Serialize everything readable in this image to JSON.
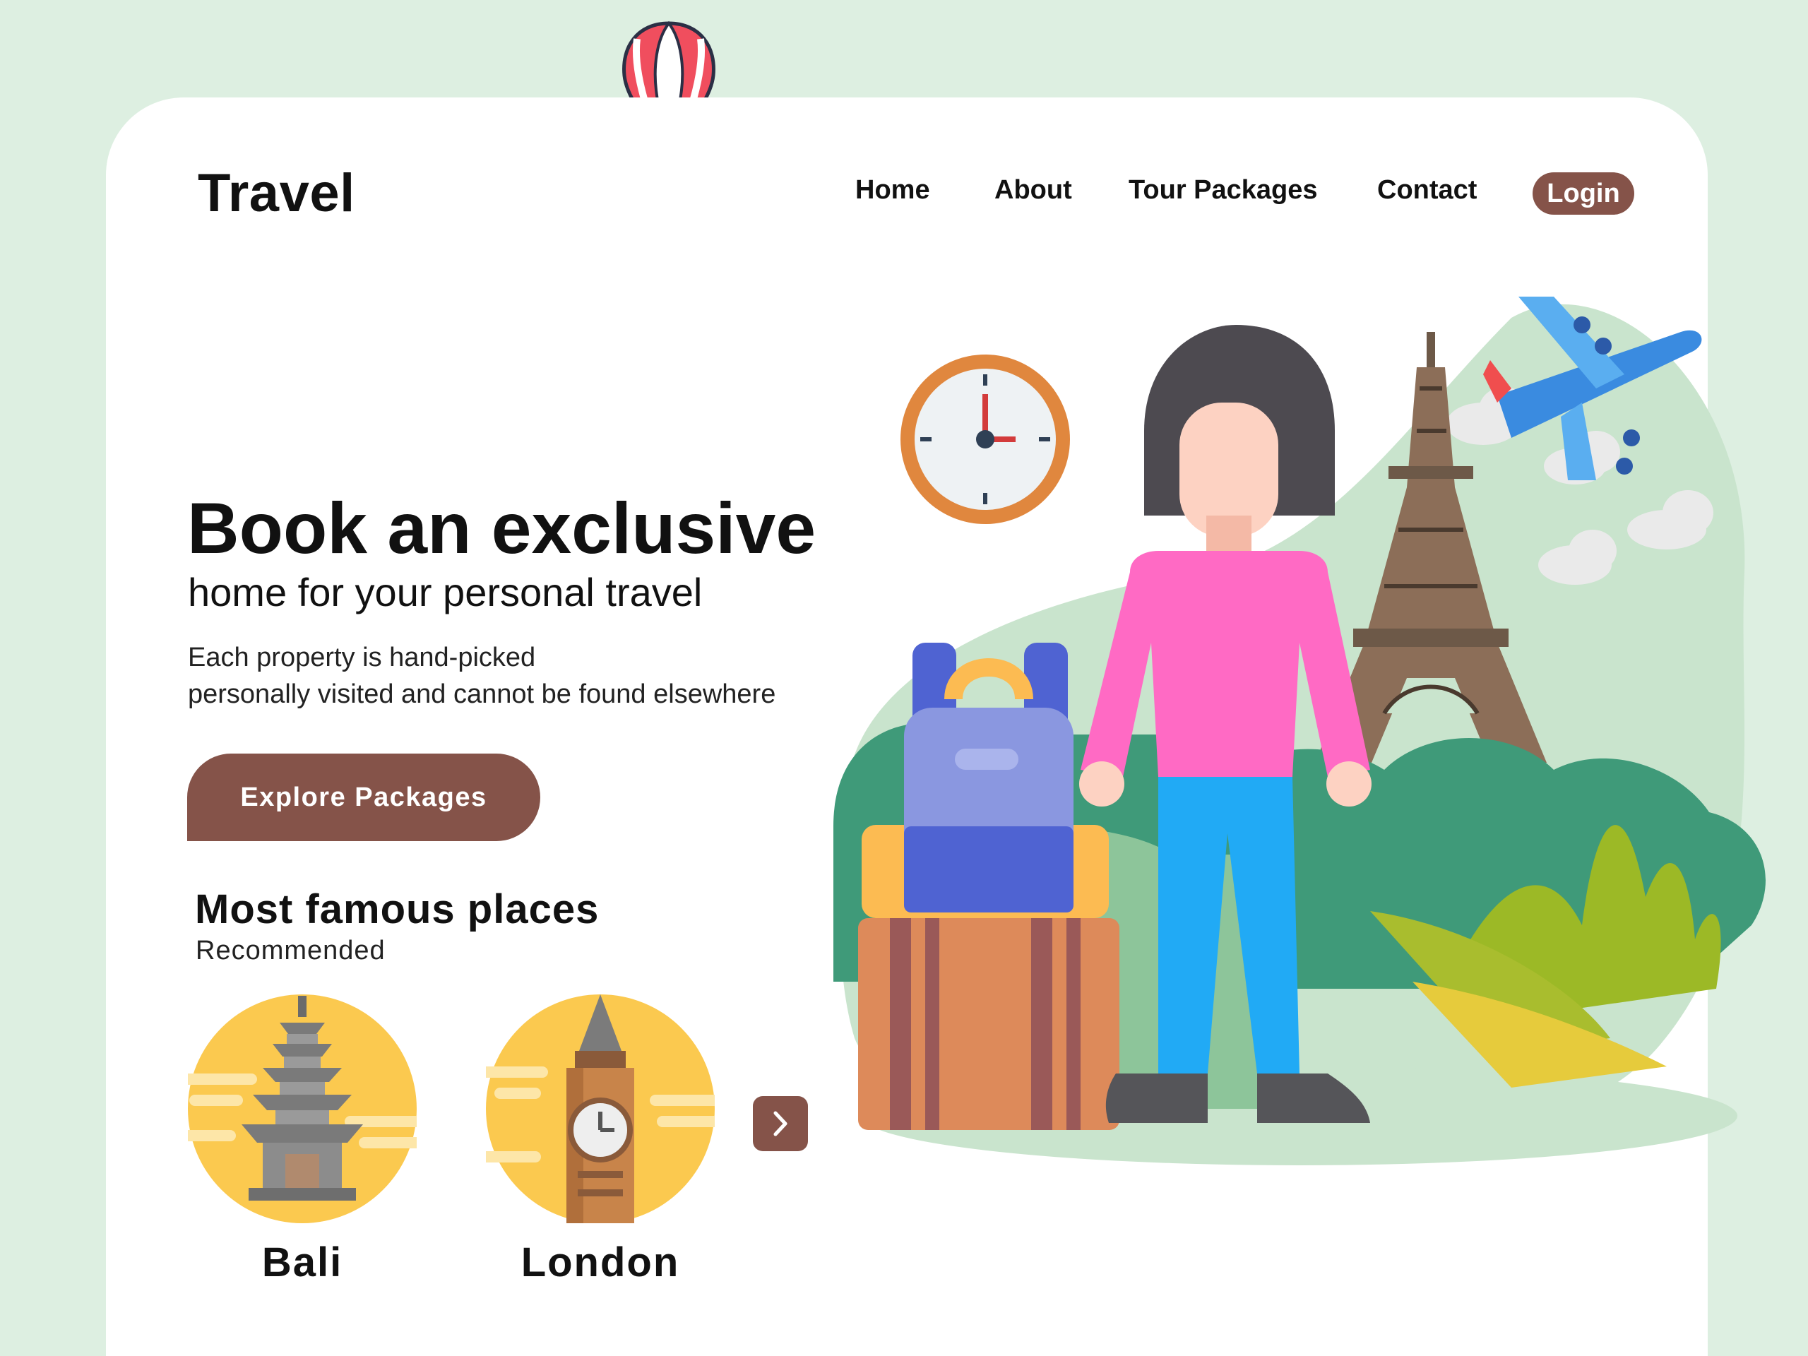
{
  "brand": {
    "logo": "Travel"
  },
  "nav": {
    "items": [
      {
        "label": "Home"
      },
      {
        "label": "About"
      },
      {
        "label": "Tour Packages"
      },
      {
        "label": "Contact"
      }
    ],
    "login_label": "Login"
  },
  "hero": {
    "title": "Book an exclusive",
    "subtitle": "home for your personal travel",
    "desc_line1": "Each property is hand-picked",
    "desc_line2": "personally visited and cannot be found elsewhere",
    "cta_label": "Explore Packages"
  },
  "famous": {
    "title": "Most famous places",
    "subtitle": "Recommended",
    "places": [
      {
        "name": "Bali",
        "icon": "bali-temple-icon"
      },
      {
        "name": "London",
        "icon": "big-ben-icon"
      }
    ],
    "next_icon": "chevron-right-icon"
  },
  "colors": {
    "accent": "#855349",
    "page_bg": "#ddefe1",
    "card_bg": "#ffffff",
    "place_circle": "#fbc94f"
  },
  "illustration": {
    "icons": [
      "hot-air-balloon-icon",
      "clock-icon",
      "airplane-icon",
      "eiffel-tower-icon",
      "traveler-woman-icon",
      "backpack-icon",
      "suitcase-icon",
      "cloud-icon",
      "bush-icon"
    ]
  }
}
